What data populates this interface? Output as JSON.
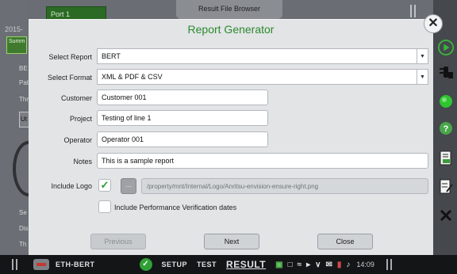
{
  "background": {
    "port_tab": "Port 1",
    "file_browser_tab": "Result File Browser",
    "date_fragment": "2015-",
    "summary_fragment": "Summ",
    "labels": [
      "BE",
      "Pat",
      "Thr",
      "Se",
      "Dis",
      "Th"
    ],
    "select_fragment": "Ut"
  },
  "dialog": {
    "title": "Report Generator",
    "fields": {
      "select_report": {
        "label": "Select Report",
        "value": "BERT"
      },
      "select_format": {
        "label": "Select Format",
        "value": "XML & PDF & CSV"
      },
      "customer": {
        "label": "Customer",
        "value": "Customer 001"
      },
      "project": {
        "label": "Project",
        "value": "Testing of line 1"
      },
      "operator": {
        "label": "Operator",
        "value": "Operator 001"
      },
      "notes": {
        "label": "Notes",
        "value": "This is a sample report"
      },
      "include_logo": {
        "label": "Include Logo",
        "checked": true,
        "browse_label": "...",
        "path": "/property/mnt/Internal/Logo/Anritsu-envision-ensure-right.png"
      },
      "performance_verification": {
        "label": "Include Performance Verification dates",
        "checked": false
      }
    },
    "buttons": {
      "previous": "Previous",
      "next": "Next",
      "close": "Close"
    }
  },
  "side_toolbar": [
    "play-icon",
    "traffic-light-icon",
    "status-led-icon",
    "help-icon",
    "save-report-icon",
    "report-edit-icon",
    "close-x-icon"
  ],
  "statusbar": {
    "app_name": "ETH-BERT",
    "setup": "SETUP",
    "test": "TEST",
    "result": "RESULT",
    "time": "14:09"
  },
  "colors": {
    "accent_green": "#2d8a2e",
    "check_green": "#2d9a31",
    "led_green": "#2fc62f"
  }
}
